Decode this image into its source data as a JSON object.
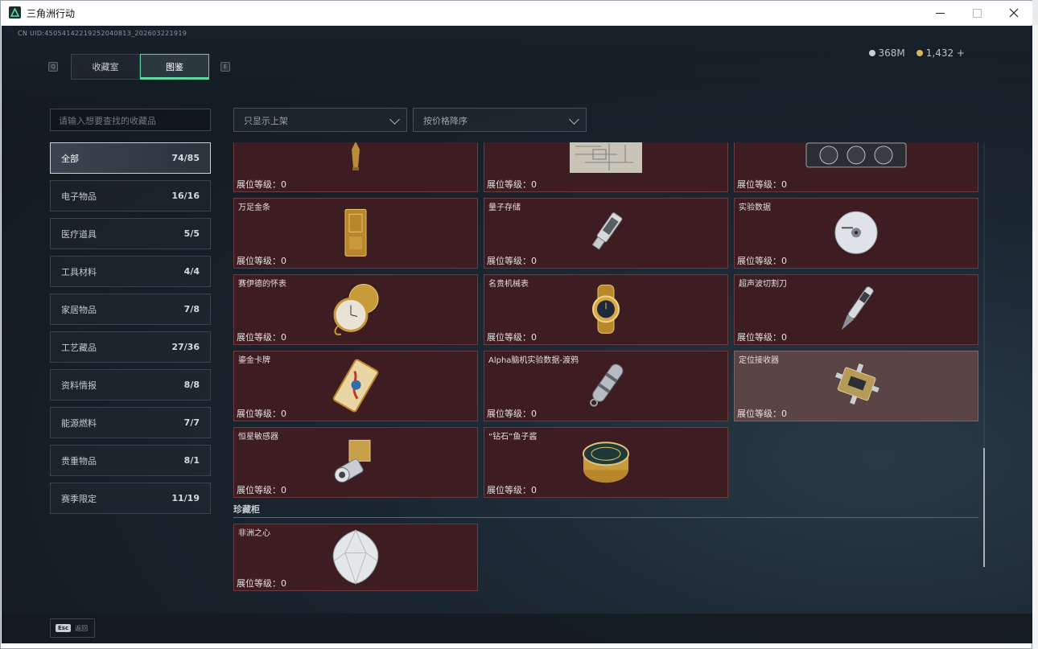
{
  "window": {
    "title": "三角洲行动"
  },
  "header": {
    "uid": "CN UID:4505414221925204081З_202603221919",
    "currency": [
      {
        "label": "368M",
        "color": "#c9ced3"
      },
      {
        "label": "1,432 +",
        "color": "#d9b45a"
      }
    ]
  },
  "tabs": {
    "prev_key": "Q",
    "next_key": "E",
    "items": [
      {
        "label": "收藏室"
      },
      {
        "label": "图鉴"
      }
    ]
  },
  "search": {
    "placeholder": "请输入想要查找的收藏品"
  },
  "filters": {
    "listing": "只显示上架",
    "sort": "按价格降序"
  },
  "categories": [
    {
      "label": "全部",
      "count": "74/85"
    },
    {
      "label": "电子物品",
      "count": "16/16"
    },
    {
      "label": "医疗道具",
      "count": "5/5"
    },
    {
      "label": "工具材料",
      "count": "4/4"
    },
    {
      "label": "家居物品",
      "count": "7/8"
    },
    {
      "label": "工艺藏品",
      "count": "27/36"
    },
    {
      "label": "资料情报",
      "count": "8/8"
    },
    {
      "label": "能源燃料",
      "count": "7/7"
    },
    {
      "label": "贵重物品",
      "count": "8/1"
    },
    {
      "label": "赛季限定",
      "count": "11/19"
    }
  ],
  "level_label": "展位等级：0",
  "items": [
    {
      "name": "",
      "icon": "trophy-icon"
    },
    {
      "name": "",
      "icon": "blueprint-icon"
    },
    {
      "name": "",
      "icon": "graphics-card-icon"
    },
    {
      "name": "万足金条",
      "icon": "gold-bar-icon"
    },
    {
      "name": "量子存储",
      "icon": "usb-drive-icon"
    },
    {
      "name": "实验数据",
      "icon": "disc-icon"
    },
    {
      "name": "赛伊德的怀表",
      "icon": "pocket-watch-icon"
    },
    {
      "name": "名贵机械表",
      "icon": "wristwatch-icon"
    },
    {
      "name": "超声波切割刀",
      "icon": "cutter-icon"
    },
    {
      "name": "鎏金卡牌",
      "icon": "card-icon"
    },
    {
      "name": "Alpha脑机实验数据-渡鸦",
      "icon": "data-canister-icon"
    },
    {
      "name": "定位接收器",
      "icon": "receiver-icon"
    },
    {
      "name": "恒星敏感器",
      "icon": "sensor-icon"
    },
    {
      "name": "“钻石”鱼子酱",
      "icon": "caviar-icon"
    }
  ],
  "showcase": {
    "title": "珍藏柜",
    "items": [
      {
        "name": "非洲之心",
        "icon": "diamond-icon"
      }
    ]
  },
  "footer": {
    "esc_key": "Esc",
    "esc_label": "返回"
  }
}
